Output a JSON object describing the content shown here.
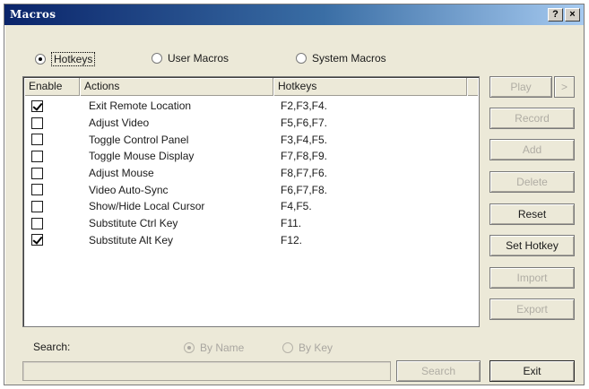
{
  "window": {
    "title": "Macros",
    "help_label": "?",
    "close_label": "×"
  },
  "tabs": {
    "hotkeys": {
      "label": "Hotkeys",
      "selected": true
    },
    "user_macros": {
      "label": "User Macros",
      "selected": false
    },
    "system_macros": {
      "label": "System Macros",
      "selected": false
    }
  },
  "list": {
    "columns": {
      "enable": "Enable",
      "actions": "Actions",
      "hotkeys": "Hotkeys"
    },
    "rows": [
      {
        "enabled": true,
        "action": "Exit Remote Location",
        "hotkeys": "F2,F3,F4."
      },
      {
        "enabled": false,
        "action": "Adjust Video",
        "hotkeys": "F5,F6,F7."
      },
      {
        "enabled": false,
        "action": "Toggle Control Panel",
        "hotkeys": "F3,F4,F5."
      },
      {
        "enabled": false,
        "action": "Toggle Mouse Display",
        "hotkeys": "F7,F8,F9."
      },
      {
        "enabled": false,
        "action": "Adjust Mouse",
        "hotkeys": "F8,F7,F6."
      },
      {
        "enabled": false,
        "action": "Video Auto-Sync",
        "hotkeys": "F6,F7,F8."
      },
      {
        "enabled": false,
        "action": "Show/Hide Local Cursor",
        "hotkeys": "F4,F5."
      },
      {
        "enabled": false,
        "action": "Substitute Ctrl Key",
        "hotkeys": "F11."
      },
      {
        "enabled": true,
        "action": "Substitute Alt Key",
        "hotkeys": "F12."
      }
    ]
  },
  "buttons": {
    "play": "Play",
    "play_arrow": ">",
    "record": "Record",
    "add": "Add",
    "delete": "Delete",
    "reset": "Reset",
    "set_hotkey": "Set Hotkey",
    "import": "Import",
    "export": "Export",
    "search": "Search",
    "exit": "Exit"
  },
  "search": {
    "label": "Search:",
    "value": "",
    "by_name": {
      "label": "By Name",
      "selected": true
    },
    "by_key": {
      "label": "By Key",
      "selected": false
    }
  }
}
